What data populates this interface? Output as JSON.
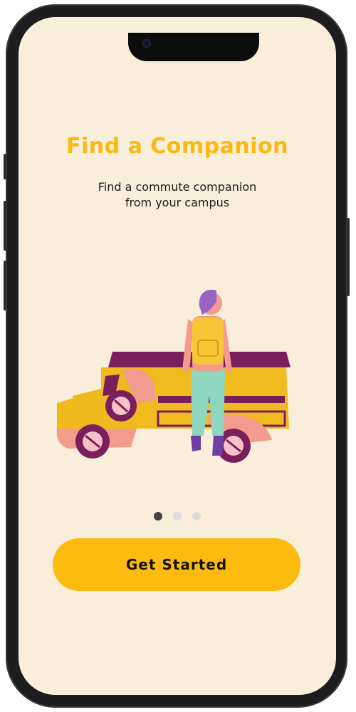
{
  "onboarding": {
    "title": "Find a Companion",
    "subtitle_line1": "Find a commute companion",
    "subtitle_line2": "from your campus",
    "illustration": "person-with-backpack-beside-jeepney",
    "page_indicator": {
      "total": 3,
      "active": 1
    },
    "cta_label": "Get Started"
  },
  "colors": {
    "background": "#f8eed9",
    "accent": "#fbb90f",
    "button": "#fdbb10",
    "dot_active": "#444444",
    "dot_inactive": "#dcdcdc"
  }
}
